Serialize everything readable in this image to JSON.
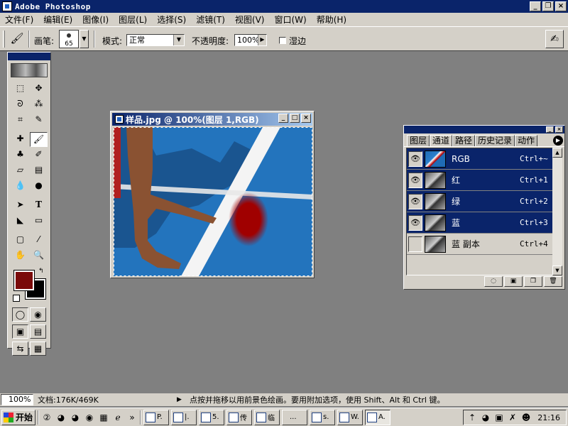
{
  "app": {
    "title": "Adobe Photoshop"
  },
  "menu": [
    "文件(F)",
    "编辑(E)",
    "图像(I)",
    "图层(L)",
    "选择(S)",
    "滤镜(T)",
    "视图(V)",
    "窗口(W)",
    "帮助(H)"
  ],
  "options": {
    "brush_label": "画笔:",
    "brush_size": "65",
    "mode_label": "模式:",
    "mode_value": "正常",
    "opacity_label": "不透明度:",
    "opacity_value": "100%",
    "wet_edges_label": "湿边"
  },
  "document": {
    "title": "样品.jpg @ 100%(图层 1,RGB)"
  },
  "panel": {
    "tabs": [
      "图层",
      "通道",
      "路径",
      "历史记录",
      "动作"
    ],
    "active_tab": "通道",
    "channels": [
      {
        "name": "RGB",
        "shortcut": "Ctrl+~",
        "visible": true,
        "selected": true
      },
      {
        "name": "红",
        "shortcut": "Ctrl+1",
        "visible": true,
        "selected": true
      },
      {
        "name": "绿",
        "shortcut": "Ctrl+2",
        "visible": true,
        "selected": true
      },
      {
        "name": "蓝",
        "shortcut": "Ctrl+3",
        "visible": true,
        "selected": true
      },
      {
        "name": "蓝 副本",
        "shortcut": "Ctrl+4",
        "visible": false,
        "selected": false
      }
    ]
  },
  "status": {
    "zoom": "100%",
    "doc_size": "文档:176K/469K",
    "hint": "点按并拖移以用前景色绘画。要用附加选项，使用 Shift、Alt 和 Ctrl 键。"
  },
  "taskbar": {
    "start_label": "开始",
    "tasks": [
      "P.",
      "|.",
      "5.",
      "传",
      "临",
      "...",
      "s.",
      "W.",
      "A."
    ],
    "clock": "21:16"
  },
  "colors": {
    "foreground": "#7a0a0a",
    "background": "#000000",
    "title_bar": "#0a246a"
  }
}
